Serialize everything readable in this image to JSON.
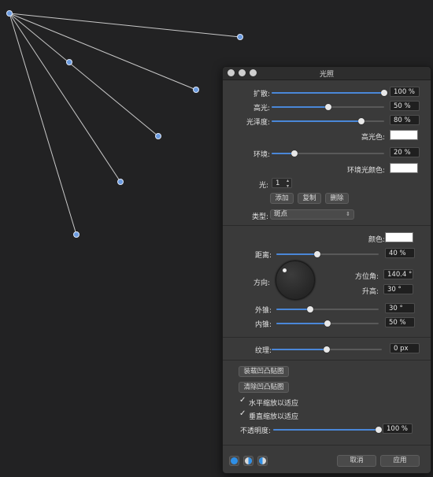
{
  "title": "光照",
  "lights": {
    "diffusion": {
      "label": "扩散:",
      "value": "100 %",
      "level": 1.0
    },
    "specular": {
      "label": "高光:",
      "value": "50 %",
      "level": 0.5
    },
    "shininess": {
      "label": "光泽度:",
      "value": "80 %",
      "level": 0.8
    },
    "specular_color_label": "高光色:",
    "ambient": {
      "label": "环境:",
      "value": "20 %",
      "level": 0.2
    },
    "ambient_color_label": "环境光颜色:",
    "light_label": "光:",
    "light_index": "1",
    "add_label": "添加",
    "copy_label": "复制",
    "delete_label": "删除",
    "type_label": "类型:",
    "type_value": "斑点"
  },
  "light_props": {
    "color_label": "颜色:",
    "distance": {
      "label": "距离:",
      "value": "40 %",
      "level": 0.4
    },
    "direction_label": "方向:",
    "azimuth": {
      "label": "方位角:",
      "value": "140.4 °"
    },
    "elevation": {
      "label": "升高:",
      "value": "30 °"
    },
    "outer_cone": {
      "label": "外锥:",
      "value": "30 °",
      "level": 0.33
    },
    "inner_cone": {
      "label": "内锥:",
      "value": "50 %",
      "level": 0.5
    }
  },
  "texture": {
    "label": "纹理:",
    "value": "0 px",
    "level": 0.5
  },
  "bump": {
    "load_label": "装载凹凸贴图",
    "clear_label": "清除凹凸贴图",
    "scale_h_label": "水平缩放以适应",
    "scale_v_label": "垂直缩放以适应",
    "check_glyph": "✓",
    "opacity": {
      "label": "不透明度:",
      "value": "100 %",
      "level": 1.0
    }
  },
  "footer": {
    "cancel_label": "取消",
    "apply_label": "应用"
  },
  "colors": {
    "accent": "#4a87d8",
    "handle": "#6b9be0",
    "line": "#c8c8c8"
  }
}
